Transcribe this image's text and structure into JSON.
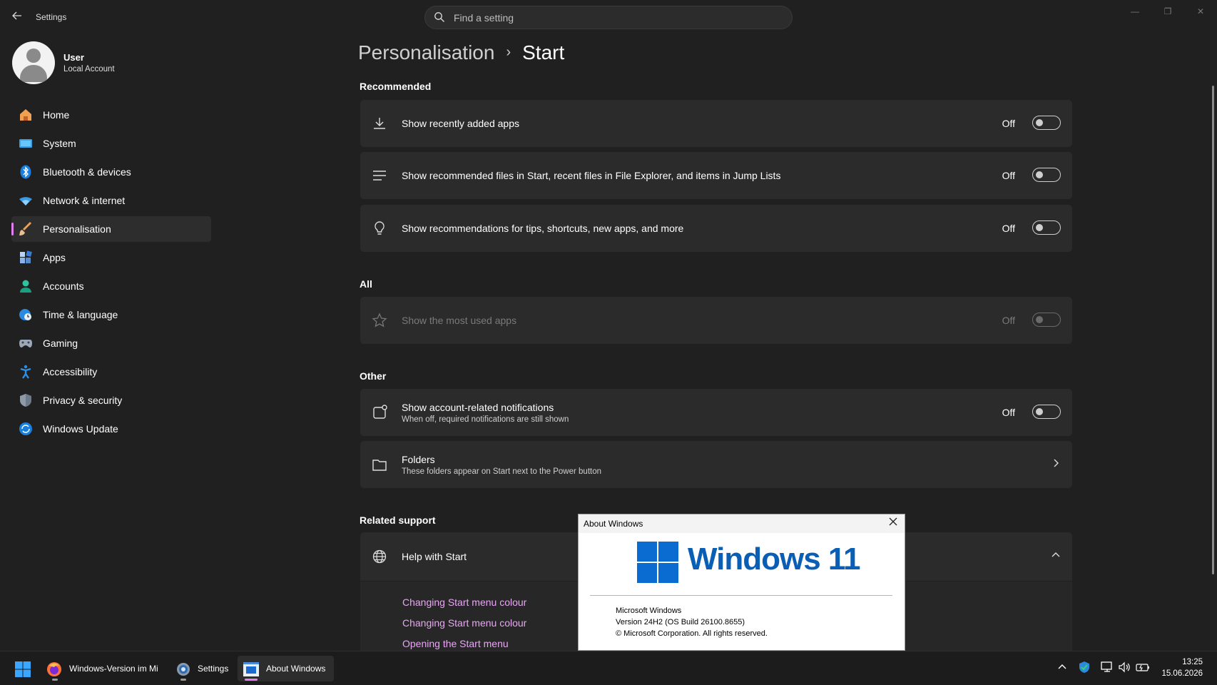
{
  "window": {
    "title": "Settings"
  },
  "search": {
    "placeholder": "Find a setting"
  },
  "profile": {
    "name": "User",
    "account_type": "Local Account"
  },
  "sidebar": {
    "items": [
      {
        "label": "Home",
        "icon": "home-icon"
      },
      {
        "label": "System",
        "icon": "system-icon"
      },
      {
        "label": "Bluetooth & devices",
        "icon": "bluetooth-icon"
      },
      {
        "label": "Network & internet",
        "icon": "wifi-icon"
      },
      {
        "label": "Personalisation",
        "icon": "brush-icon",
        "selected": true
      },
      {
        "label": "Apps",
        "icon": "apps-icon"
      },
      {
        "label": "Accounts",
        "icon": "accounts-icon"
      },
      {
        "label": "Time & language",
        "icon": "globe-clock-icon"
      },
      {
        "label": "Gaming",
        "icon": "gamepad-icon"
      },
      {
        "label": "Accessibility",
        "icon": "accessibility-icon"
      },
      {
        "label": "Privacy & security",
        "icon": "shield-icon"
      },
      {
        "label": "Windows Update",
        "icon": "update-icon"
      }
    ]
  },
  "breadcrumb": {
    "parent": "Personalisation",
    "separator": "›",
    "current": "Start"
  },
  "sections": {
    "recommended": "Recommended",
    "all": "All",
    "other": "Other",
    "related_support": "Related support"
  },
  "settings": {
    "recent_apps": {
      "label": "Show recently added apps",
      "state": "Off"
    },
    "recommended_files": {
      "label": "Show recommended files in Start, recent files in File Explorer, and items in Jump Lists",
      "state": "Off"
    },
    "tips": {
      "label": "Show recommendations for tips, shortcuts, new apps, and more",
      "state": "Off"
    },
    "most_used": {
      "label": "Show the most used apps",
      "state": "Off",
      "disabled": true
    },
    "account_notifications": {
      "label": "Show account-related notifications",
      "description": "When off, required notifications are still shown",
      "state": "Off"
    },
    "folders": {
      "label": "Folders",
      "description": "These folders appear on Start next to the Power button"
    }
  },
  "help": {
    "title": "Help with Start",
    "links": [
      "Changing Start menu colour",
      "Changing Start menu colour",
      "Opening the Start menu"
    ]
  },
  "about_dialog": {
    "title": "About Windows",
    "logo_text": "Windows 11",
    "product": "Microsoft Windows",
    "version": "Version 24H2 (OS Build 26100.8655)",
    "copyright": "© Microsoft Corporation. All rights reserved."
  },
  "taskbar": {
    "apps": [
      {
        "label": "Windows-Version im Mi",
        "icon": "firefox-icon"
      },
      {
        "label": "Settings",
        "icon": "settings-gear-icon"
      },
      {
        "label": "About Windows",
        "icon": "winver-icon",
        "active": true
      }
    ],
    "time": "13:25",
    "date": "15.06.2026"
  },
  "colors": {
    "accent": "#e27ff0",
    "link": "#e9a6f5",
    "windows_blue": "#0a6cd0",
    "background": "#202020",
    "card": "#2b2b2b"
  }
}
